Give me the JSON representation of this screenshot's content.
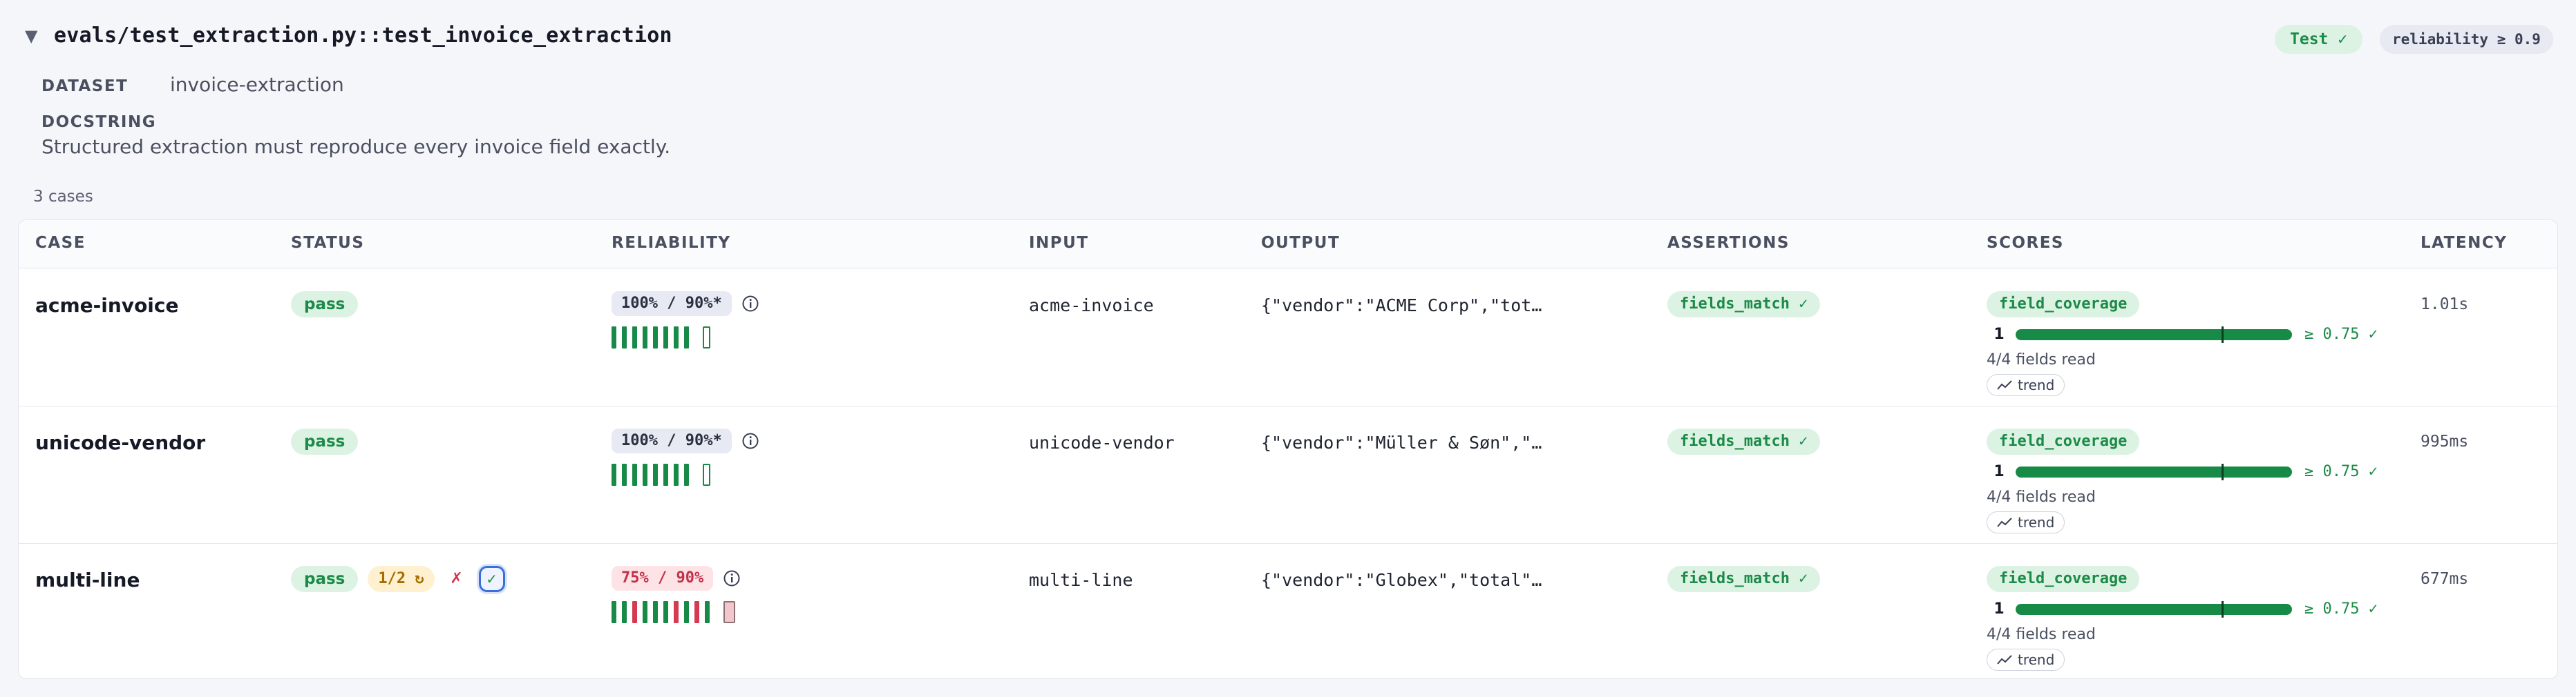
{
  "header": {
    "chevron": "▼",
    "test_path": "evals/test_extraction.py::test_invoice_extraction",
    "test_badge": "Test ✓",
    "reliability_badge": "reliability ≥ 0.9"
  },
  "meta": {
    "dataset_label": "DATASET",
    "dataset_value": "invoice-extraction",
    "docstring_label": "DOCSTRING",
    "docstring_value": "Structured extraction must reproduce every invoice field exactly."
  },
  "cases_count": "3 cases",
  "table": {
    "columns": [
      "CASE",
      "STATUS",
      "RELIABILITY",
      "INPUT",
      "OUTPUT",
      "ASSERTIONS",
      "SCORES",
      "LATENCY"
    ],
    "rows": [
      {
        "case": "acme-invoice",
        "status": "pass",
        "reliability": "100% / 90%*",
        "input": "acme-invoice",
        "output": "{\"vendor\":\"ACME Corp\",\"tot…",
        "assertion": "fields_match ✓",
        "score_name": "field_coverage",
        "score_value": "1",
        "score_pass": "≥ 0.75 ✓",
        "score_detail": "4/4 fields read",
        "trend": "trend",
        "latency": "1.01s"
      },
      {
        "case": "unicode-vendor",
        "status": "pass",
        "reliability": "100% / 90%*",
        "input": "unicode-vendor",
        "output": "{\"vendor\":\"Müller & Søn\",\"…",
        "assertion": "fields_match ✓",
        "score_name": "field_coverage",
        "score_value": "1",
        "score_pass": "≥ 0.75 ✓",
        "score_detail": "4/4 fields read",
        "trend": "trend",
        "latency": "995ms"
      },
      {
        "case": "multi-line",
        "status": "pass",
        "retry": "1/2 ↻",
        "attempt_fail": "✗",
        "attempt_pass": "✓",
        "reliability": "75% / 90%",
        "input": "multi-line",
        "output": "{\"vendor\":\"Globex\",\"total\"…",
        "assertion": "fields_match ✓",
        "score_name": "field_coverage",
        "score_value": "1",
        "score_pass": "≥ 0.75 ✓",
        "score_detail": "4/4 fields read",
        "trend": "trend",
        "latency": "677ms"
      }
    ]
  },
  "colors": {
    "pass_green": "#1c8a48",
    "fail_red": "#d43a52",
    "accent_blue": "#3b6fd8"
  },
  "icons": [
    "chevron-down-icon",
    "info-icon",
    "trend-icon"
  ]
}
